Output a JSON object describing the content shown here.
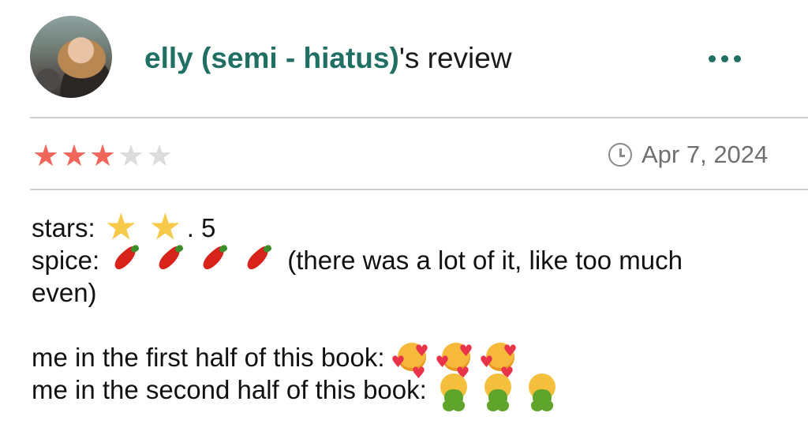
{
  "review": {
    "username": "elly (semi - hiatus)",
    "title_suffix": "'s review",
    "more_icon": "more-horizontal-icon",
    "rating": 3,
    "rating_max": 5,
    "date": "Apr 7, 2024",
    "date_icon": "clock-icon"
  },
  "body": {
    "stars_label": "stars:",
    "stars_suffix": ". 5",
    "spice_label": "spice:",
    "spice_comment_1": "(there was a lot of it, like too much",
    "spice_comment_2": "even)",
    "first_half": "me in the first half of this book:",
    "second_half": "me in the second half of this book:"
  },
  "colors": {
    "username": "#1f6f62",
    "star_on": "#f0665a",
    "star_off": "#dcdcdc"
  }
}
